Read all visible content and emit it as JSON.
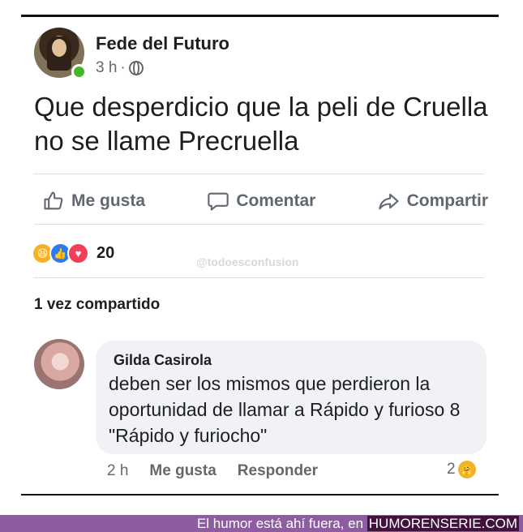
{
  "post": {
    "author": "Fede del Futuro",
    "time": "3 h",
    "separator": "·",
    "text": "Que desperdicio que la peli de Cruella no se llame Precruella",
    "actions": {
      "like": "Me gusta",
      "comment": "Comentar",
      "share": "Compartir"
    },
    "reaction_count": "20",
    "watermark": "@todoesconfusion",
    "shared": "1 vez compartido"
  },
  "comment": {
    "author": "Gilda Casirola",
    "text": "deben ser los mismos que perdieron la oportunidad de llamar a Rápido y furioso 8 \"Rápido y furiocho\"",
    "time": "2 h",
    "like": "Me gusta",
    "reply": "Responder",
    "reaction_count": "2"
  },
  "banner": {
    "prefix": "El humor está ahí fuera, en",
    "site": "HUMORENSERIE.COM"
  },
  "colors": {
    "text": "#1c1e21",
    "muted": "#65676b",
    "online": "#42b72a",
    "like_blue": "#2d7bf4",
    "love_red": "#f33e58",
    "haha_yellow": "#f7b125",
    "banner_purple": "#8e5ca0"
  },
  "icons": {
    "like": "thumbs-up-icon",
    "comment": "speech-bubble-icon",
    "share": "share-arrow-icon",
    "audience": "globe-icon"
  }
}
